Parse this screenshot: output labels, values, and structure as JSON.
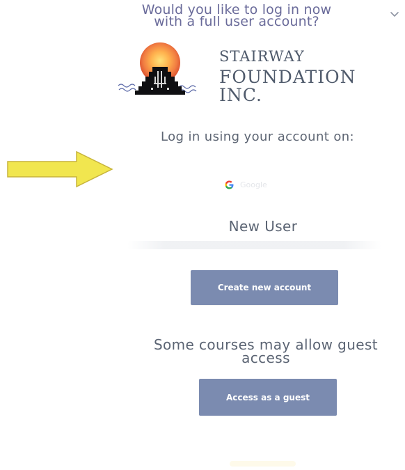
{
  "prompt": {
    "line1": "Would you like to log in now",
    "line2": "with a full user account?"
  },
  "logo": {
    "row1": "Stairway",
    "row2": "Foundation Inc."
  },
  "login": {
    "heading": "Log in using your account on:",
    "google_label": "Google"
  },
  "new_user": {
    "title": "New User",
    "create_button": "Create new account"
  },
  "guest": {
    "title": "Some courses may allow guest access",
    "button": "Access as a guest"
  },
  "colors": {
    "button_bg": "#7b8bb0",
    "prompt_text": "#6a6b9a",
    "arrow_fill": "#f1e64f",
    "arrow_stroke": "#c7b43c"
  },
  "icons": {
    "dropdown": "chevron-down-icon",
    "google": "google-icon",
    "arrow": "arrow-right-icon",
    "logo": "stairway-foundation-logo"
  }
}
